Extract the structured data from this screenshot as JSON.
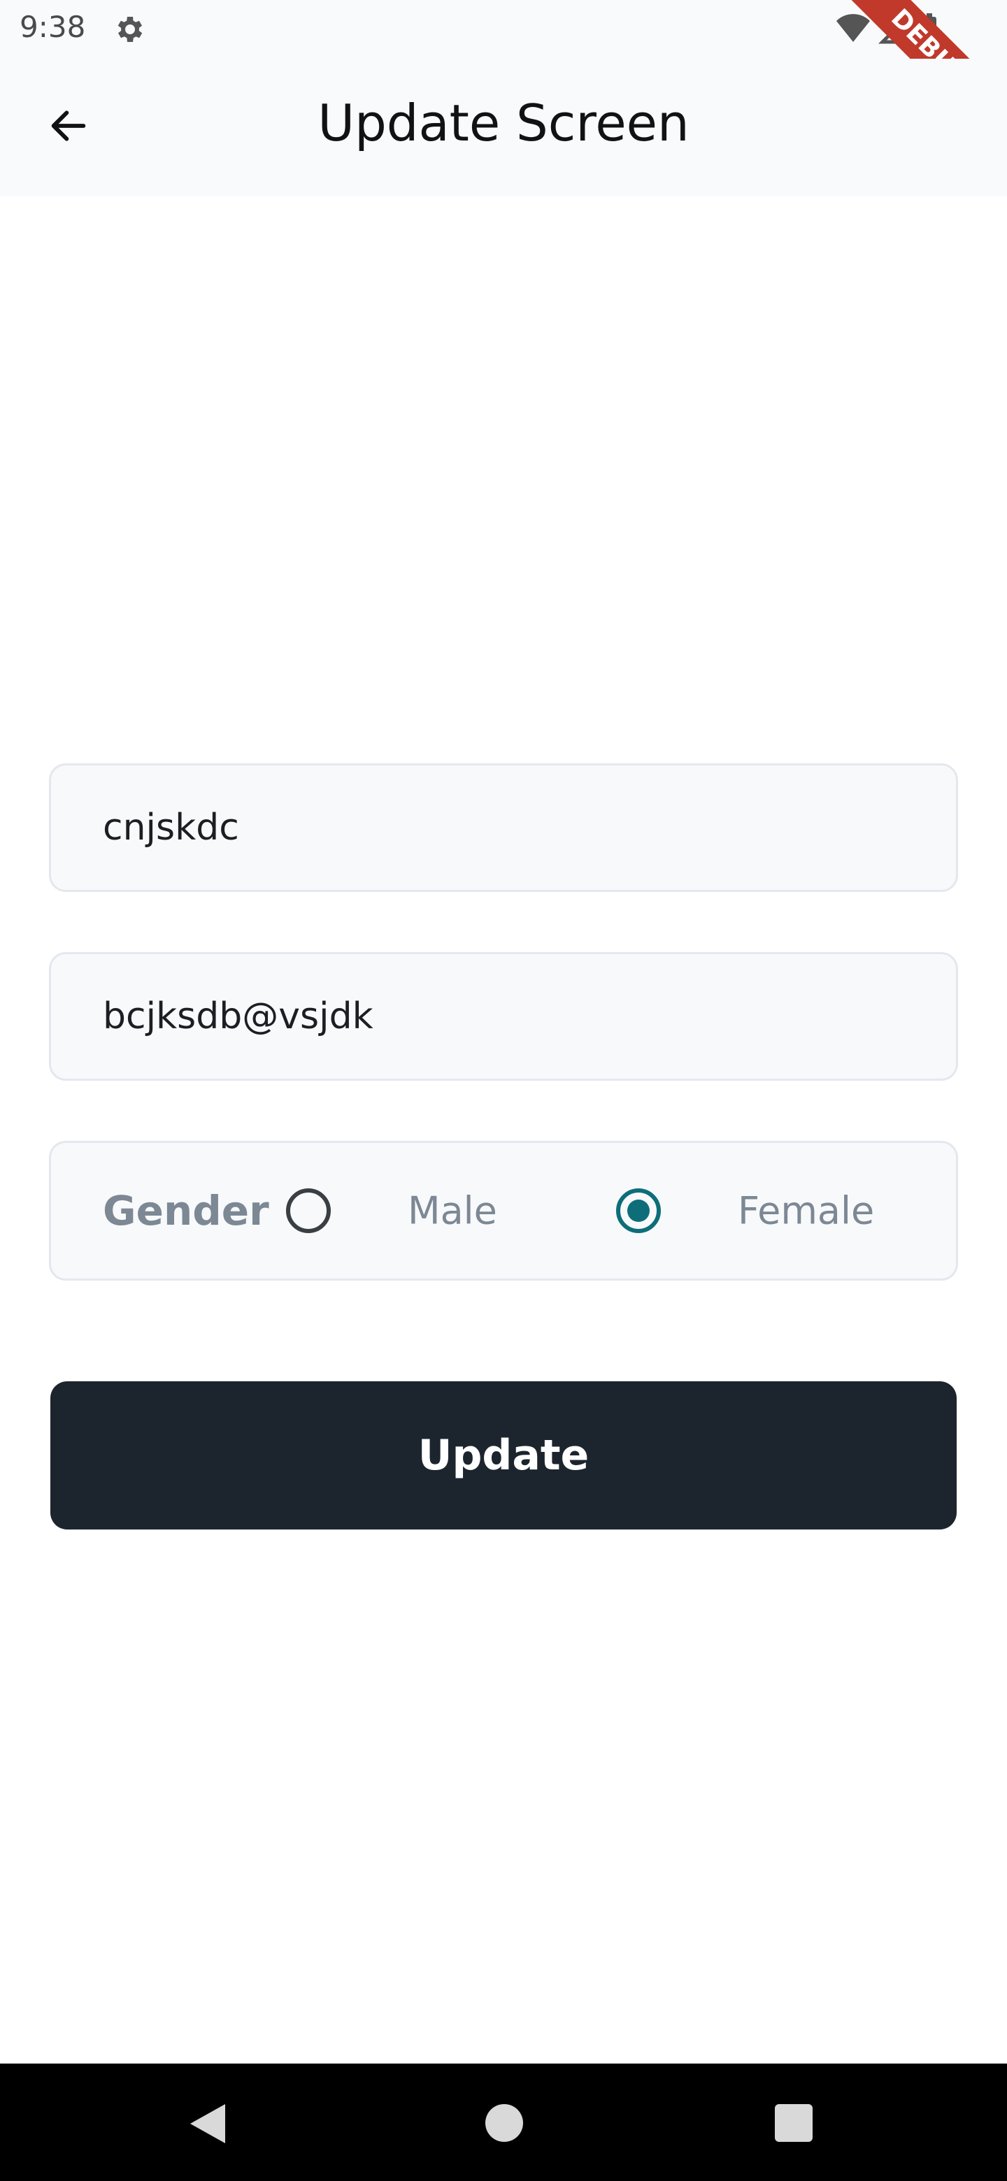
{
  "status": {
    "time": "9:38"
  },
  "appbar": {
    "title": "Update Screen"
  },
  "debug_banner": "DEBUG",
  "form": {
    "name_value": "cnjskdc",
    "email_value": "bcjksdb@vsjdk",
    "gender": {
      "label": "Gender",
      "options": [
        "Male",
        "Female"
      ],
      "selected": "Female"
    }
  },
  "update_button": {
    "label": "Update"
  },
  "colors": {
    "accent": "#0d6e7a",
    "button": "#1c252e"
  }
}
